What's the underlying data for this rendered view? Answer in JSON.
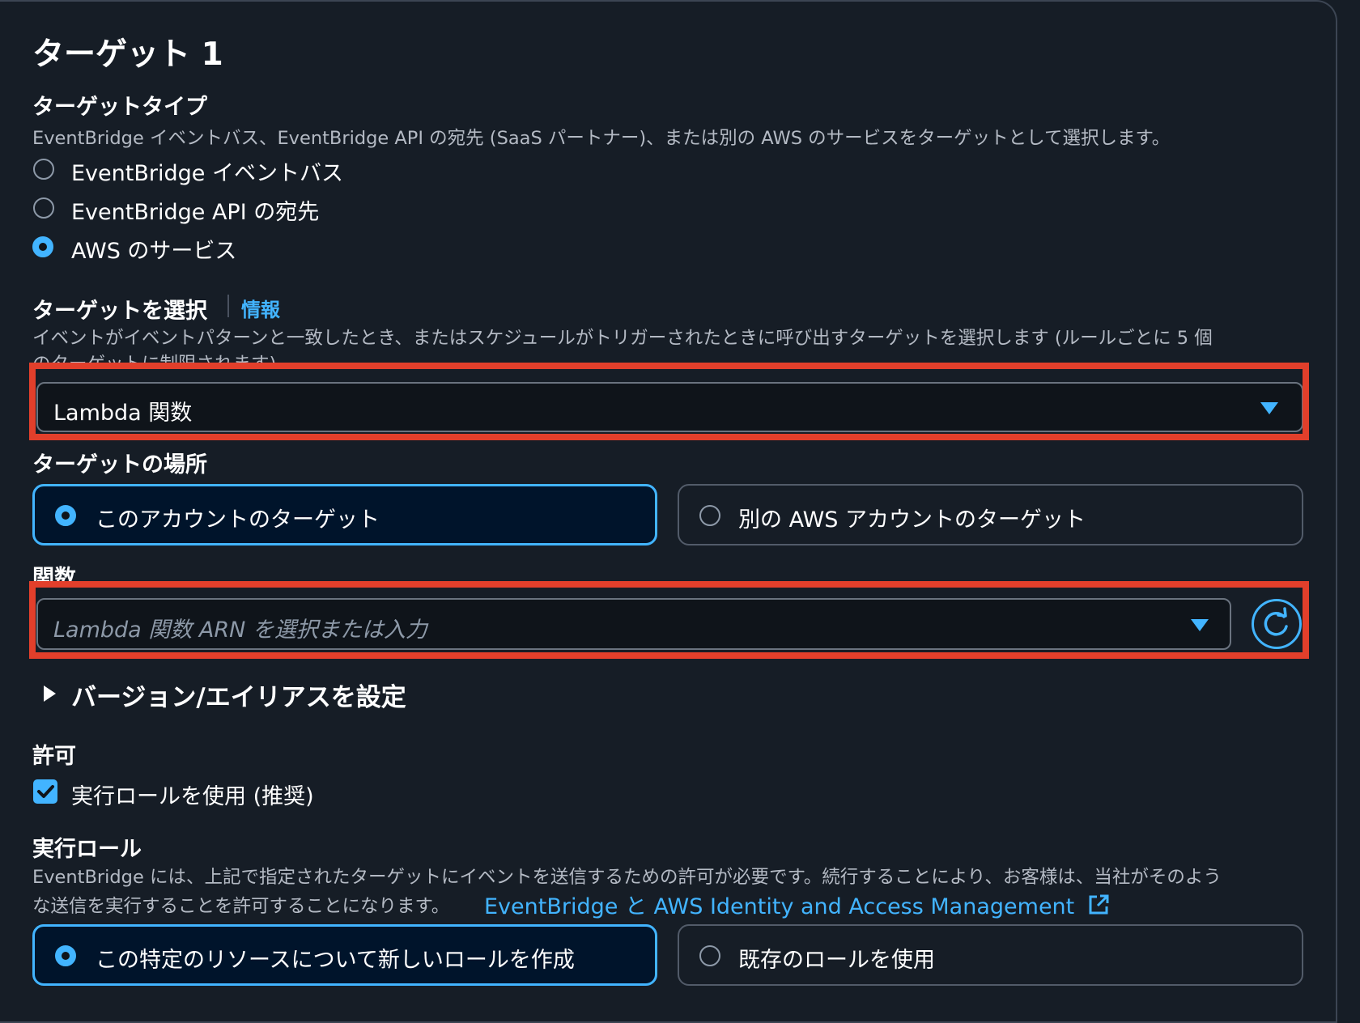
{
  "section": {
    "title": "ターゲット 1"
  },
  "target_type": {
    "label": "ターゲットタイプ",
    "description": "EventBridge イベントバス、EventBridge API の宛先 (SaaS パートナー)、または別の AWS のサービスをターゲットとして選択します。",
    "options": [
      {
        "label": "EventBridge イベントバス",
        "selected": false
      },
      {
        "label": "EventBridge API の宛先",
        "selected": false
      },
      {
        "label": "AWS のサービス",
        "selected": true
      }
    ]
  },
  "select_target": {
    "label": "ターゲットを選択",
    "info_link": "情報",
    "description_line1": "イベントがイベントパターンと一致したとき、またはスケジュールがトリガーされたときに呼び出すターゲットを選択します (ルールごとに 5 個",
    "description_line2": "のターゲットに制限されます)",
    "value": "Lambda 関数"
  },
  "target_location": {
    "label": "ターゲットの場所",
    "options": [
      {
        "label": "このアカウントのターゲット",
        "selected": true
      },
      {
        "label": "別の AWS アカウントのターゲット",
        "selected": false
      }
    ]
  },
  "function": {
    "label": "関数",
    "placeholder": "Lambda 関数 ARN を選択または入力"
  },
  "version_alias": {
    "label": "バージョン/エイリアスを設定"
  },
  "permissions": {
    "label": "許可",
    "checkbox_label": "実行ロールを使用 (推奨)",
    "checked": true
  },
  "execution_role": {
    "label": "実行ロール",
    "description_line1": "EventBridge には、上記で指定されたターゲットにイベントを送信するための許可が必要です。続行することにより、お客様は、当社がそのよう",
    "description_line2": "な送信を実行することを許可することになります。",
    "link_text": "EventBridge と AWS Identity and Access Management",
    "options": [
      {
        "label": "この特定のリソースについて新しいロールを作成",
        "selected": true
      },
      {
        "label": "既存のロールを使用",
        "selected": false
      }
    ]
  },
  "colors": {
    "background": "#161d26",
    "accent": "#42b4ff",
    "highlight_box": "#e23f2b",
    "selected_tile_bg": "#00142b"
  }
}
